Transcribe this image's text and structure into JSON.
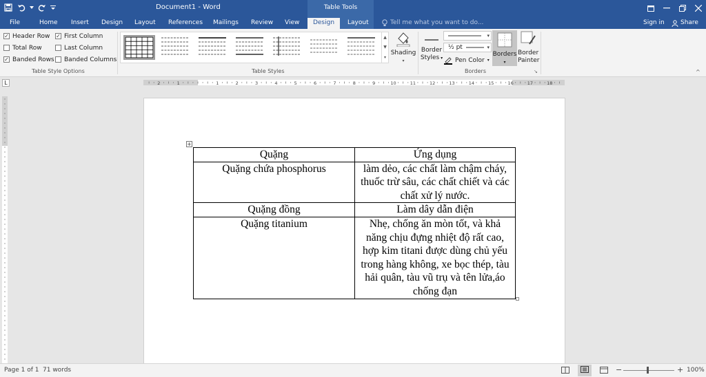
{
  "title": {
    "document": "Document1 - Word",
    "contextual_group": "Table Tools"
  },
  "tabs": {
    "file": "File",
    "home": "Home",
    "insert": "Insert",
    "design": "Design",
    "layout": "Layout",
    "references": "References",
    "mailings": "Mailings",
    "review": "Review",
    "view": "View",
    "table_design": "Design",
    "table_layout": "Layout"
  },
  "tell_me": {
    "placeholder": "Tell me what you want to do..."
  },
  "account": {
    "sign_in": "Sign in",
    "share": "Share"
  },
  "style_options": {
    "header_row": {
      "label": "Header Row",
      "checked": true
    },
    "first_column": {
      "label": "First Column",
      "checked": true
    },
    "total_row": {
      "label": "Total Row",
      "checked": false
    },
    "last_column": {
      "label": "Last Column",
      "checked": false
    },
    "banded_rows": {
      "label": "Banded Rows",
      "checked": true
    },
    "banded_columns": {
      "label": "Banded Columns",
      "checked": false
    },
    "group_label": "Table Style Options"
  },
  "table_styles": {
    "group_label": "Table Styles",
    "shading_label": "Shading"
  },
  "borders_group": {
    "border_styles_line1": "Border",
    "border_styles_line2": "Styles",
    "pen_weight": "½ pt",
    "pen_color": "Pen Color",
    "borders": "Borders",
    "border_painter_line1": "Border",
    "border_painter_line2": "Painter",
    "group_label": "Borders"
  },
  "ruler": {
    "numbers": [
      "2",
      "1",
      "1",
      "2",
      "3",
      "4",
      "5",
      "6",
      "7",
      "8",
      "9",
      "10",
      "11",
      "12",
      "13",
      "14",
      "15",
      "16",
      "17",
      "18"
    ]
  },
  "table": {
    "header": {
      "col1": "Quặng",
      "col2": "Ứng dụng"
    },
    "rows": [
      {
        "col1": "Quặng chứa phosphorus",
        "col2": "làm dẻo, các chất làm chậm cháy, thuốc trừ sâu, các chất chiết và các chất xử lý nước."
      },
      {
        "col1": "Quặng đồng",
        "col2": "Làm dây dẫn điện"
      },
      {
        "col1": "Quặng titanium",
        "col2": "Nhẹ, chống ăn mòn tốt, và khả năng chịu đựng nhiệt độ rất cao, hợp kim titani được dùng chủ yếu trong hàng không, xe bọc thép, tàu hải quân, tàu vũ trụ và tên lửa,áo chống đạn"
      }
    ]
  },
  "status": {
    "page": "Page 1 of 1",
    "words": "71 words",
    "zoom": "100%"
  },
  "colors": {
    "ribbon_blue": "#2b579a",
    "contextual_band": "#3b69a8"
  },
  "icons": [
    "save-icon",
    "undo-icon",
    "redo-icon",
    "customize-qat-icon",
    "ribbon-display-icon",
    "minimize-icon",
    "restore-icon",
    "close-icon",
    "lightbulb-icon",
    "person-icon",
    "shading-icon",
    "borders-icon",
    "border-painter-icon",
    "table-move-icon",
    "zoom-out-icon",
    "zoom-in-icon"
  ]
}
